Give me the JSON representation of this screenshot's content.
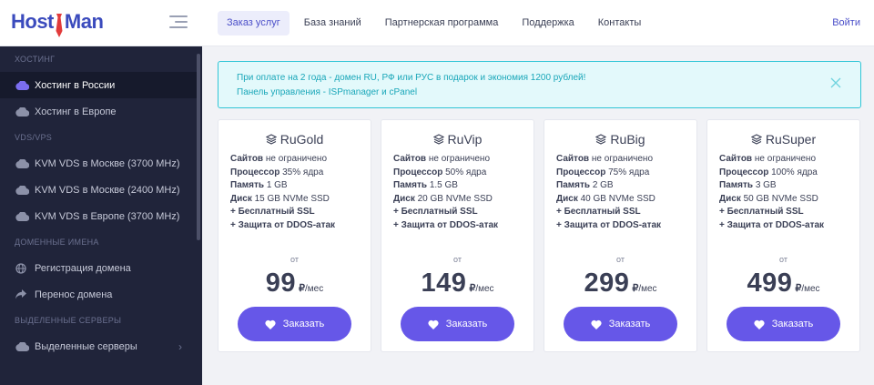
{
  "brand": {
    "part1": "Host",
    "part2": "Man"
  },
  "nav": {
    "items": [
      "Заказ услуг",
      "База знаний",
      "Партнерская программа",
      "Поддержка",
      "Контакты"
    ],
    "login": "Войти"
  },
  "sidebar": {
    "sections": [
      {
        "title": "Хостинг",
        "items": [
          {
            "label": "Хостинг в России",
            "icon": "cloud-icon"
          },
          {
            "label": "Хостинг в Европе",
            "icon": "cloud-icon"
          }
        ]
      },
      {
        "title": "VDS/VPS",
        "items": [
          {
            "label": "KVM VDS в Москве (3700 MHz)",
            "icon": "cloud-icon"
          },
          {
            "label": "KVM VDS в Москве (2400 MHz)",
            "icon": "cloud-icon"
          },
          {
            "label": "KVM VDS в Европе (3700 MHz)",
            "icon": "cloud-icon"
          }
        ]
      },
      {
        "title": "Доменные имена",
        "items": [
          {
            "label": "Регистрация домена",
            "icon": "globe-icon"
          },
          {
            "label": "Перенос домена",
            "icon": "share-arrow-icon"
          }
        ]
      },
      {
        "title": "Выделенные серверы",
        "items": [
          {
            "label": "Выделенные серверы",
            "icon": "cloud-icon"
          }
        ]
      }
    ]
  },
  "notice": {
    "line1": "При оплате на 2 года - домен RU, РФ или РУС в подарок и экономия 1200 рублей!",
    "line2": "Панель управления - ISPmanager и cPanel"
  },
  "plans": [
    {
      "name": "RuGold",
      "sites_label": "Сайтов",
      "sites": "не ограничено",
      "cpu_label": "Процессор",
      "cpu": "35% ядра",
      "ram_label": "Память",
      "ram": "1 GB",
      "disk_label": "Диск",
      "disk": "15 GB NVMe SSD",
      "ssl": "+ Бесплатный SSL",
      "ddos": "+ Защита от DDOS-атак",
      "from": "от",
      "price": "99",
      "currency": "₽",
      "period": "/мес",
      "button": "Заказать"
    },
    {
      "name": "RuVip",
      "sites_label": "Сайтов",
      "sites": "не ограничено",
      "cpu_label": "Процессор",
      "cpu": "50% ядра",
      "ram_label": "Память",
      "ram": "1.5 GB",
      "disk_label": "Диск",
      "disk": "20 GB NVMe SSD",
      "ssl": "+ Бесплатный SSL",
      "ddos": "+ Защита от DDOS-атак",
      "from": "от",
      "price": "149",
      "currency": "₽",
      "period": "/мес",
      "button": "Заказать"
    },
    {
      "name": "RuBig",
      "sites_label": "Сайтов",
      "sites": "не ограничено",
      "cpu_label": "Процессор",
      "cpu": "75% ядра",
      "ram_label": "Память",
      "ram": "2 GB",
      "disk_label": "Диск",
      "disk": "40 GB NVMe SSD",
      "ssl": "+ Бесплатный SSL",
      "ddos": "+ Защита от DDOS-атак",
      "from": "от",
      "price": "299",
      "currency": "₽",
      "period": "/мес",
      "button": "Заказать"
    },
    {
      "name": "RuSuper",
      "sites_label": "Сайтов",
      "sites": "не ограничено",
      "cpu_label": "Процессор",
      "cpu": "100% ядра",
      "ram_label": "Память",
      "ram": "3 GB",
      "disk_label": "Диск",
      "disk": "50 GB NVMe SSD",
      "ssl": "+ Бесплатный SSL",
      "ddos": "+ Защита от DDOS-атак",
      "from": "от",
      "price": "499",
      "currency": "₽",
      "period": "/мес",
      "button": "Заказать"
    }
  ],
  "colors": {
    "accent": "#6657e8",
    "sidebar": "#20243a",
    "notice_border": "#31c5d6",
    "notice_text": "#1aa7b9"
  }
}
